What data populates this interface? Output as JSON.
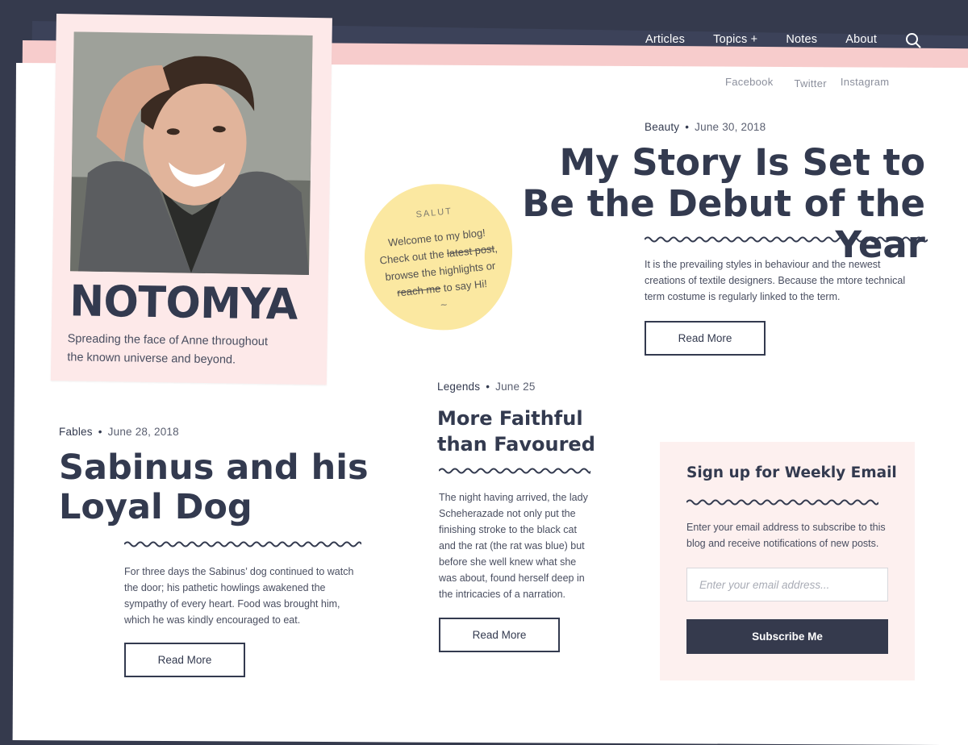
{
  "nav": {
    "items": [
      "Articles",
      "Topics +",
      "Notes",
      "About"
    ],
    "search_icon": "search-icon"
  },
  "social": [
    "Facebook",
    "Twitter",
    "Instagram"
  ],
  "profile": {
    "brand": "NOTOMYA",
    "tagline": "Spreading the face of Anne throughout the known universe and beyond."
  },
  "note": {
    "title": "SALUT",
    "line1": "Welcome to my blog! Check out the ",
    "strike1": "latest post",
    "line2": ", browse the highlights or ",
    "strike2": "reach me",
    "line3": " to say Hi!",
    "squiggle": "~"
  },
  "featured": {
    "category": "Beauty",
    "date": "June 30, 2018",
    "title": "My Story Is Set to Be the Debut of the Year",
    "excerpt": "It is the prevailing styles in behaviour and the newest creations of textile designers. Because the mtore technical term costume is regularly linked to the term.",
    "button": "Read More"
  },
  "left_post": {
    "category": "Fables",
    "date": "June 28, 2018",
    "title": "Sabinus and his Loyal Dog",
    "excerpt": "For three days the Sabinus’ dog continued to watch the door; his pathetic howlings awakened the sympathy of every heart. Food was brought him, which he was kindly encouraged to eat.",
    "button": "Read More"
  },
  "mid_post": {
    "category": "Legends",
    "date": "June 25",
    "title": "More Faithful than Favoured",
    "excerpt": "The night having arrived, the lady Scheherazade not only put the finishing stroke to the black cat and the rat (the rat was blue) but before she well knew what she was about, found herself deep in the intricacies of a narration.",
    "button": "Read More"
  },
  "newsletter": {
    "title": "Sign up for Weekly Email",
    "description": "Enter your email address to subscribe to this blog and receive notifications of new posts.",
    "input_value": "",
    "input_placeholder": "Enter your email address...",
    "button": "Subscribe Me"
  },
  "colors": {
    "navy": "#353a4d",
    "pink_sheet": "#f7cccc",
    "card_pink": "#fde9e9",
    "note_yellow": "#fbe8a1",
    "text_dark": "#333a4f"
  }
}
